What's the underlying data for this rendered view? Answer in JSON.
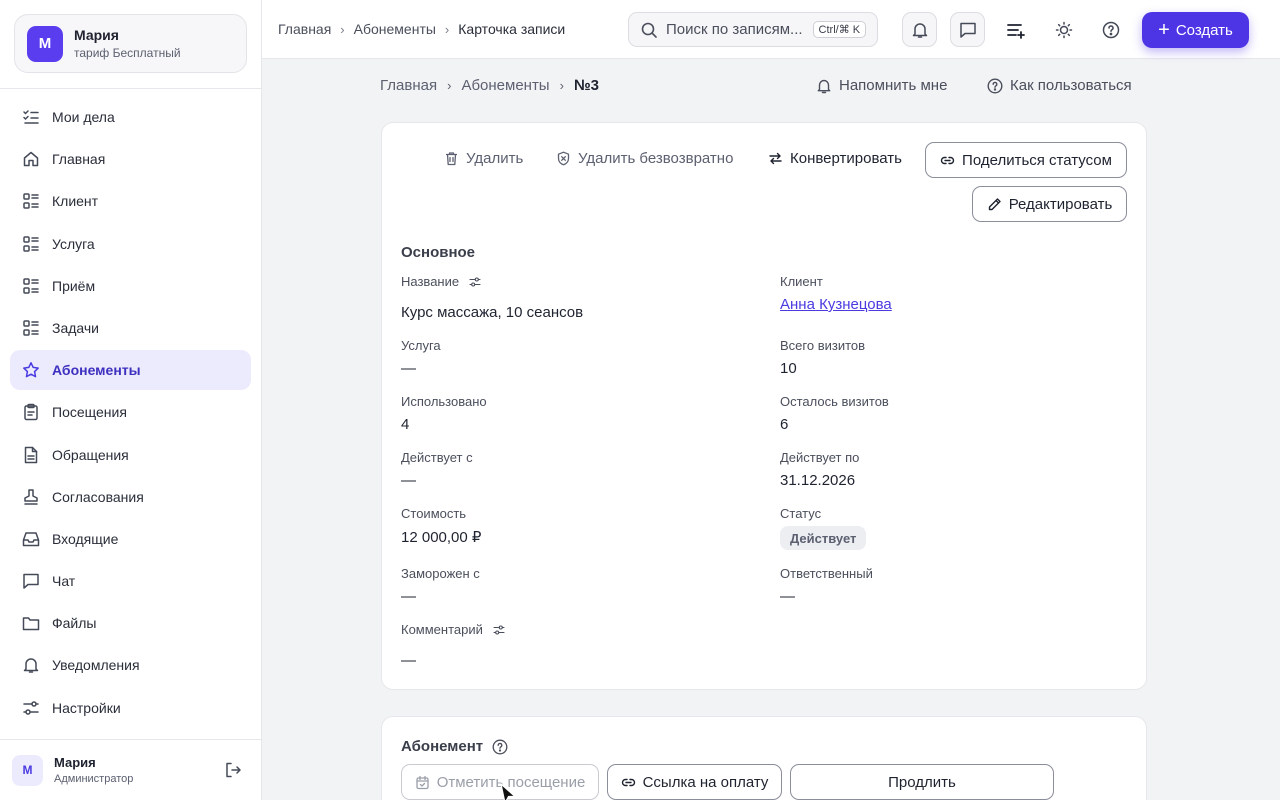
{
  "account": {
    "initial": "М",
    "name": "Мария",
    "plan": "тариф Бесплатный"
  },
  "nav": [
    {
      "label": "Мои дела",
      "icon": "checklist-icon",
      "active": false
    },
    {
      "label": "Главная",
      "icon": "home-icon",
      "active": false
    },
    {
      "label": "Клиент",
      "icon": "list-icon",
      "active": false
    },
    {
      "label": "Услуга",
      "icon": "list-icon",
      "active": false
    },
    {
      "label": "Приём",
      "icon": "list-icon",
      "active": false
    },
    {
      "label": "Задачи",
      "icon": "list-icon",
      "active": false
    },
    {
      "label": "Абонементы",
      "icon": "star-icon",
      "active": true
    },
    {
      "label": "Посещения",
      "icon": "clipboard-icon",
      "active": false
    },
    {
      "label": "Обращения",
      "icon": "document-icon",
      "active": false
    },
    {
      "label": "Согласования",
      "icon": "stamp-icon",
      "active": false
    },
    {
      "label": "Входящие",
      "icon": "inbox-icon",
      "active": false
    },
    {
      "label": "Чат",
      "icon": "chat-icon",
      "active": false
    },
    {
      "label": "Файлы",
      "icon": "folder-icon",
      "active": false
    },
    {
      "label": "Уведомления",
      "icon": "bell-icon",
      "active": false
    },
    {
      "label": "Настройки",
      "icon": "sliders-icon",
      "active": false
    }
  ],
  "user": {
    "initial": "М",
    "name": "Мария",
    "role": "Администратор"
  },
  "topbar": {
    "breadcrumbs": [
      "Главная",
      "Абонементы",
      "Карточка записи"
    ],
    "search_placeholder": "Поиск по записям...",
    "search_shortcut": "Ctrl/⌘ K",
    "create_label": "Создать"
  },
  "page": {
    "breadcrumbs": [
      "Главная",
      "Абонементы",
      "№3"
    ],
    "remind_label": "Напомнить мне",
    "howto_label": "Как пользоваться"
  },
  "actions": {
    "delete": "Удалить",
    "delete_forever": "Удалить безвозвратно",
    "convert": "Конвертировать",
    "share_status": "Поделиться статусом",
    "edit": "Редактировать"
  },
  "main_section": {
    "title": "Основное",
    "name_label": "Название",
    "name_value": "Курс массажа, 10 сеансов",
    "client_label": "Клиент",
    "client_value": "Анна Кузнецова",
    "service_label": "Услуга",
    "service_value": "—",
    "total_label": "Всего визитов",
    "total_value": "10",
    "used_label": "Использовано",
    "used_value": "4",
    "left_label": "Осталось визитов",
    "left_value": "6",
    "from_label": "Действует с",
    "from_value": "—",
    "to_label": "Действует по",
    "to_value": "31.12.2026",
    "cost_label": "Стоимость",
    "cost_value": "12 000,00 ₽",
    "status_label": "Статус",
    "status_value": "Действует",
    "frozen_label": "Заморожен с",
    "frozen_value": "—",
    "owner_label": "Ответственный",
    "owner_value": "—",
    "comment_label": "Комментарий",
    "comment_value": "—"
  },
  "subscription": {
    "title": "Абонемент",
    "mark_visit": "Отметить посещение",
    "payment_link": "Ссылка на оплату",
    "extend": "Продлить"
  },
  "colors": {
    "accent": "#4d35e6",
    "active_bg": "#eceafd",
    "page_bg": "#f2f3f5"
  }
}
